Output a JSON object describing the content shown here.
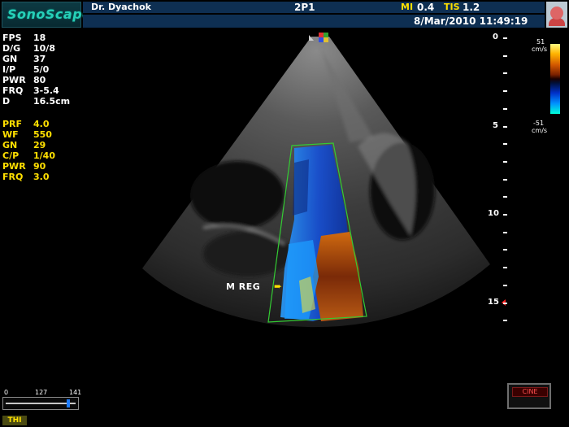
{
  "header": {
    "logo_text": "SonoScape",
    "operator": "Dr. Dyachok",
    "probe_mode": "2P1",
    "mi_label": "MI",
    "mi_value": "0.4",
    "tis_label": "TIS",
    "tis_value": "1.2",
    "datetime": "8/Mar/2010 11:49:19"
  },
  "bmode_params": [
    {
      "key": "FPS",
      "value": "18"
    },
    {
      "key": "D/G",
      "value": "10/8"
    },
    {
      "key": "GN",
      "value": "37"
    },
    {
      "key": "I/P",
      "value": "5/0"
    },
    {
      "key": "PWR",
      "value": "80"
    },
    {
      "key": "FRQ",
      "value": "3-5.4"
    },
    {
      "key": "D",
      "value": "16.5cm"
    }
  ],
  "color_params": [
    {
      "key": "PRF",
      "value": "4.0"
    },
    {
      "key": "WF",
      "value": "550"
    },
    {
      "key": "GN",
      "value": "29"
    },
    {
      "key": "C/P",
      "value": "1/40"
    },
    {
      "key": "PWR",
      "value": "90"
    },
    {
      "key": "FRQ",
      "value": "3.0"
    }
  ],
  "depth_scale": {
    "labels": [
      "0",
      "5",
      "10",
      "15"
    ]
  },
  "color_map": {
    "top_value": "51",
    "top_unit": "cm/s",
    "bottom_value": "-51",
    "bottom_unit": "cm/s"
  },
  "annotation": {
    "label": "M REG",
    "arrow_glyph": "➨"
  },
  "slider": {
    "min_label": "0",
    "mid_label": "127",
    "max_label": "141",
    "fraction": 0.9
  },
  "thi_label": "THI",
  "cine_label": "CINE",
  "colors": {
    "header_bg": "#0e2f52",
    "logo_text": "#26d0b8",
    "highlight_yellow": "#ffe000",
    "roi_green": "#33cc33"
  }
}
